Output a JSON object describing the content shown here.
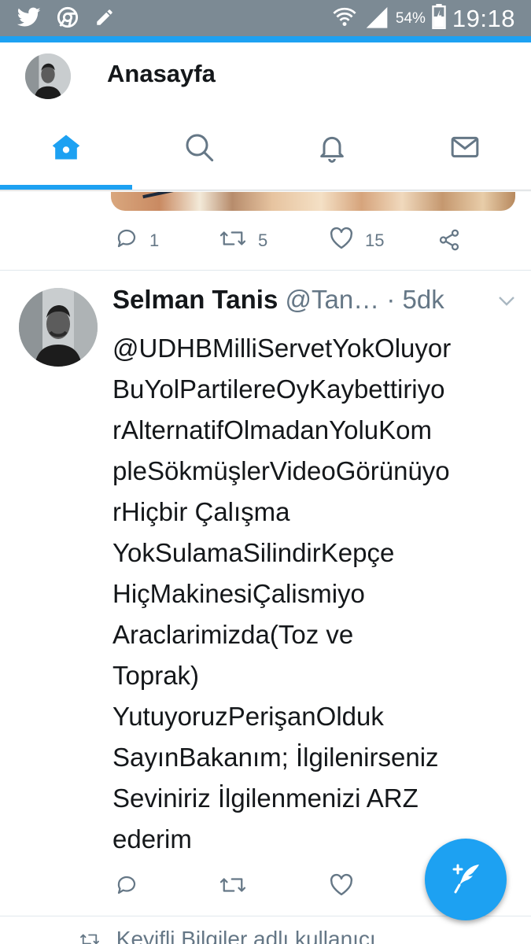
{
  "status_bar": {
    "battery_percent": "54%",
    "time": "19:18",
    "icons": [
      "twitter-icon",
      "chrome-icon",
      "pencil-icon",
      "wifi-icon",
      "signal-icon",
      "battery-icon"
    ]
  },
  "header": {
    "title": "Anasayfa",
    "tabs": [
      {
        "name": "home",
        "icon": "home-icon",
        "active": true
      },
      {
        "name": "search",
        "icon": "search-icon",
        "active": false
      },
      {
        "name": "notifications",
        "icon": "bell-icon",
        "active": false
      },
      {
        "name": "messages",
        "icon": "mail-icon",
        "active": false
      }
    ]
  },
  "prev_tweet": {
    "reply_count": "1",
    "retweet_count": "5",
    "like_count": "15"
  },
  "tweet": {
    "name": "Selman Tanis",
    "handle": "@Tan…",
    "separator": "·",
    "time": "5dk",
    "lines": [
      "@UDHBMilliServetYokOluyor",
      "BuYolPartilereOyKaybettiriyo",
      "rAlternatifOlmadanYoluKom",
      "pleSökmüşlerVideoGörünüyo",
      "rHiçbir  Çalışma",
      "YokSulamaSilindirKepçe",
      "HiçMakinesiÇalismiyo",
      "Araclarimizda(Toz ve",
      "Toprak)",
      "YutuyoruzPerişanOlduk",
      "SayınBakanım; İlgilenirseniz",
      "Seviniriz İlgilenmenizi ARZ",
      "ederim"
    ]
  },
  "next_tweet": {
    "text": "Keyifli Bilgiler adlı kullanıcı"
  },
  "colors": {
    "accent": "#1da1f2",
    "status_bar": "#7c8a94",
    "text_primary": "#14171a",
    "text_secondary": "#657786"
  }
}
